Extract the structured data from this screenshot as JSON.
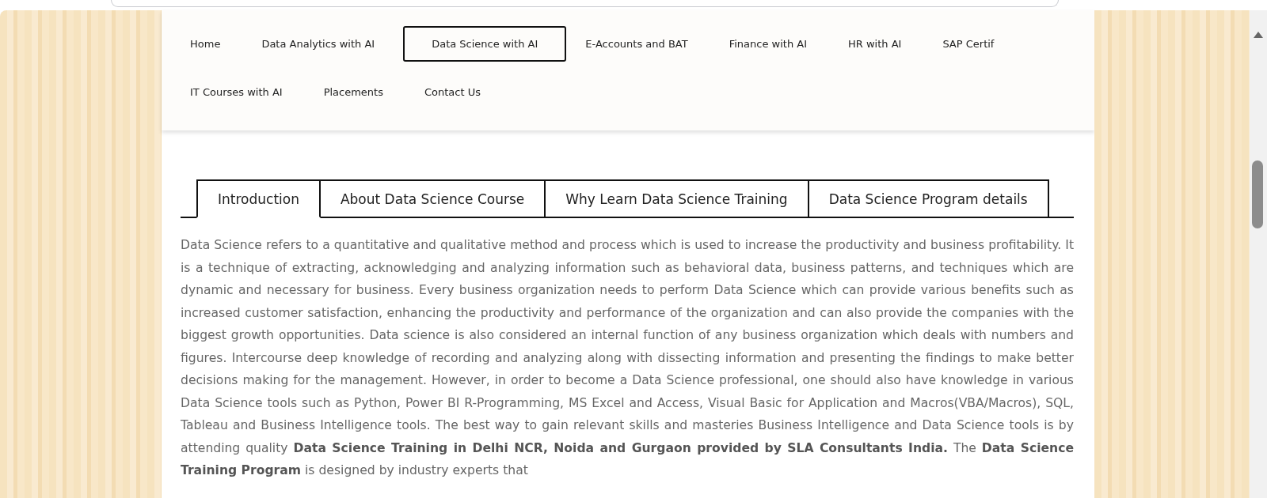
{
  "nav": {
    "items": [
      {
        "label": "Home",
        "selected": false
      },
      {
        "label": "Data Analytics with AI",
        "selected": false
      },
      {
        "label": "Data Science with AI",
        "selected": true
      },
      {
        "label": "E-Accounts and BAT",
        "selected": false
      },
      {
        "label": "Finance with AI",
        "selected": false
      },
      {
        "label": "HR with AI",
        "selected": false
      },
      {
        "label": "SAP Certif",
        "selected": false
      },
      {
        "label": "IT Courses with AI",
        "selected": false
      },
      {
        "label": "Placements",
        "selected": false
      },
      {
        "label": "Contact Us",
        "selected": false
      }
    ]
  },
  "tabs": [
    {
      "label": "Introduction",
      "selected": true
    },
    {
      "label": "About Data Science Course",
      "selected": false
    },
    {
      "label": "Why Learn Data Science Training",
      "selected": false
    },
    {
      "label": "Data Science Program details",
      "selected": false
    }
  ],
  "content": {
    "paragraph": "Data Science refers to a quantitative and qualitative method and process which is used to increase the productivity and business profitability. It is a technique of extracting, acknowledging and analyzing information such as behavioral data, business patterns, and techniques which are dynamic and necessary for business. Every business organization needs to perform Data Science which can provide various benefits such as increased customer satisfaction, enhancing the productivity and performance of the organization and can also provide the companies with the biggest growth opportunities. Data science is also considered an internal function of any business organization which deals with numbers and figures. Intercourse deep knowledge of recording and analyzing along with dissecting information and presenting the findings to make better decisions making for the management. However, in order to become a Data Science professional, one should also have knowledge in various Data Science tools such as Python, Power BI R-Programming, MS Excel and Access, Visual Basic for Application and Macros(VBA/Macros), SQL, Tableau and Business Intelligence tools. The best way to gain relevant skills and masteries Business Intelligence and Data Science tools is by attending quality **Data Science Training in Delhi NCR, Noida and Gurgaon provided by SLA Consultants India.** The **Data Science Training Program** is designed by industry experts that"
  }
}
